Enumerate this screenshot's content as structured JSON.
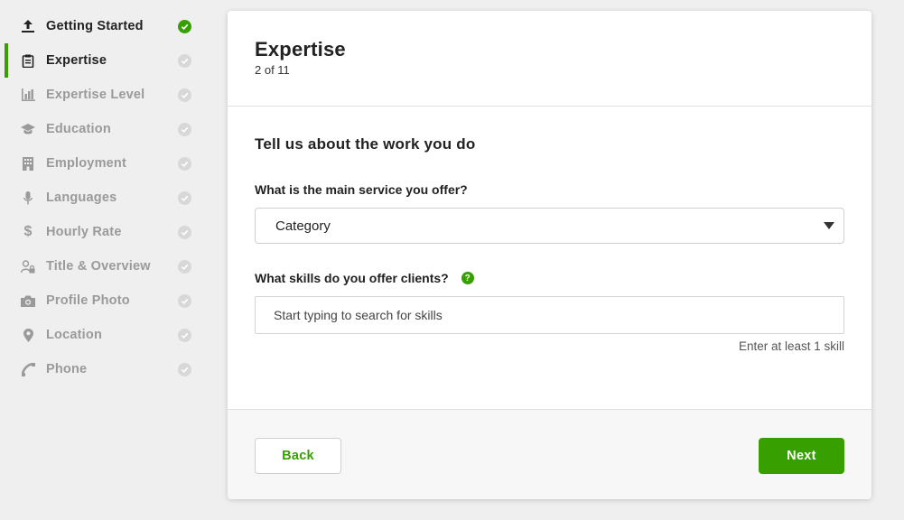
{
  "colors": {
    "accent": "#37a000",
    "pending": "#d8d8d8"
  },
  "sidebar": {
    "items": [
      {
        "label": "Getting Started",
        "icon": "upload-icon",
        "state": "done"
      },
      {
        "label": "Expertise",
        "icon": "clipboard-icon",
        "state": "active"
      },
      {
        "label": "Expertise Level",
        "icon": "bar-chart-icon",
        "state": "pending"
      },
      {
        "label": "Education",
        "icon": "graduation-cap-icon",
        "state": "pending"
      },
      {
        "label": "Employment",
        "icon": "building-icon",
        "state": "pending"
      },
      {
        "label": "Languages",
        "icon": "microphone-icon",
        "state": "pending"
      },
      {
        "label": "Hourly Rate",
        "icon": "dollar-icon",
        "state": "pending"
      },
      {
        "label": "Title & Overview",
        "icon": "user-lock-icon",
        "state": "pending"
      },
      {
        "label": "Profile Photo",
        "icon": "camera-icon",
        "state": "pending"
      },
      {
        "label": "Location",
        "icon": "map-pin-icon",
        "state": "pending"
      },
      {
        "label": "Phone",
        "icon": "phone-icon",
        "state": "pending"
      }
    ]
  },
  "card": {
    "title": "Expertise",
    "step": "2 of 11",
    "section_title": "Tell us about the work you do",
    "service_question": "What is the main service you offer?",
    "service_select_value": "Category",
    "skills_question": "What skills do you offer clients?",
    "help_icon": "?",
    "skills_placeholder": "Start typing to search for skills",
    "skills_hint": "Enter at least 1 skill"
  },
  "footer": {
    "back_label": "Back",
    "next_label": "Next"
  }
}
